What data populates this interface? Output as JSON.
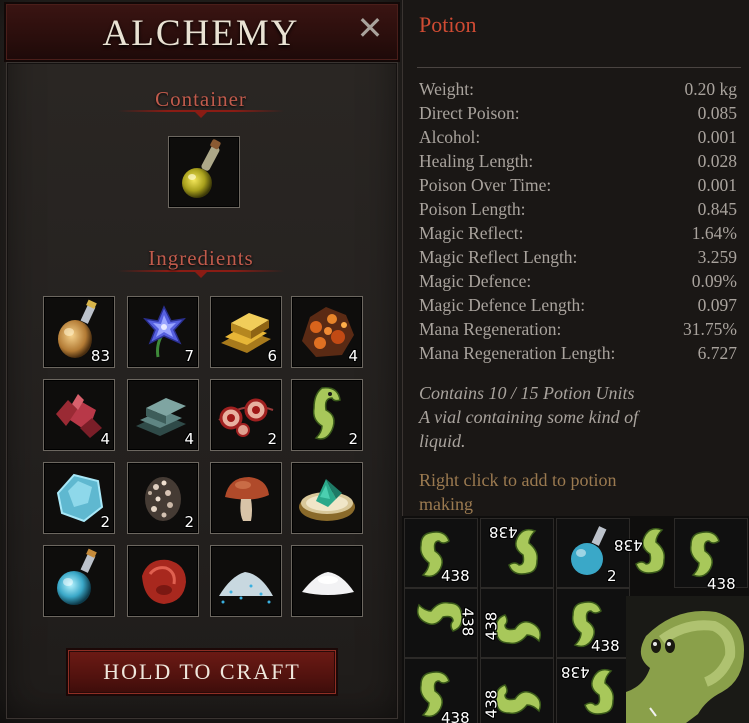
{
  "window": {
    "title": "ALCHEMY",
    "close_label": "✕",
    "container_heading": "Container",
    "ingredients_heading": "Ingredients",
    "craft_button": "HOLD TO CRAFT"
  },
  "container_slot": {
    "icon": "potion-vial-yellow-icon"
  },
  "ingredients": [
    {
      "icon": "potion-flask-gold-icon",
      "count": "83"
    },
    {
      "icon": "blue-flower-icon",
      "count": "7"
    },
    {
      "icon": "gold-ingot-icon",
      "count": "6"
    },
    {
      "icon": "fire-ore-icon",
      "count": "4"
    },
    {
      "icon": "red-crystal-icon",
      "count": "4"
    },
    {
      "icon": "iron-ingot-icon",
      "count": "4"
    },
    {
      "icon": "red-eyes-icon",
      "count": "2"
    },
    {
      "icon": "seahorse-icon",
      "count": "2"
    },
    {
      "icon": "ice-crystal-icon",
      "count": "2"
    },
    {
      "icon": "pebbles-icon",
      "count": "2"
    },
    {
      "icon": "mushroom-icon",
      "count": ""
    },
    {
      "icon": "gem-bowl-icon",
      "count": ""
    },
    {
      "icon": "blue-potion-icon",
      "count": ""
    },
    {
      "icon": "raw-meat-icon",
      "count": ""
    },
    {
      "icon": "blue-salt-icon",
      "count": ""
    },
    {
      "icon": "white-powder-icon",
      "count": ""
    }
  ],
  "tooltip": {
    "title": "Potion",
    "stats": [
      {
        "label": "Weight:",
        "value": "0.20 kg"
      },
      {
        "label": "Direct Poison:",
        "value": "0.085"
      },
      {
        "label": "Alcohol:",
        "value": "0.001"
      },
      {
        "label": "Healing Length:",
        "value": "0.028"
      },
      {
        "label": "Poison Over Time:",
        "value": "0.001"
      },
      {
        "label": "Poison Length:",
        "value": "0.845"
      },
      {
        "label": "Magic Reflect:",
        "value": "1.64%"
      },
      {
        "label": "Magic Reflect Length:",
        "value": "3.259"
      },
      {
        "label": "Magic Defence:",
        "value": "0.09%"
      },
      {
        "label": "Magic Defence Length:",
        "value": "0.097"
      },
      {
        "label": "Mana Regeneration:",
        "value": "31.75%"
      },
      {
        "label": "Mana Regeneration Length:",
        "value": "6.727"
      }
    ],
    "desc_line1": "Contains 10 / 15 Potion Units",
    "desc_line2": "A vial containing some kind of",
    "desc_line3": "liquid.",
    "hint_line1": "Right click to add to potion",
    "hint_line2": "making"
  },
  "inventory": {
    "counts": [
      "438",
      "438",
      "438",
      "438",
      "438",
      "438",
      "438",
      "438",
      "438",
      "438"
    ],
    "partial_count": "2"
  },
  "colors": {
    "accent_red": "#c15b4c",
    "tooltip_title": "#d04b33",
    "stat_text": "#a9a39d",
    "hint_text": "#9b7a50"
  }
}
